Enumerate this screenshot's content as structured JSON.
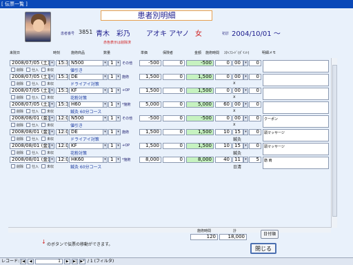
{
  "window": {
    "title": "[ 伝票一覧 ]"
  },
  "header": {
    "title": "患者別明細",
    "patient_no_label": "患者番号",
    "patient_no": "3851",
    "name_kanji": "青木　彩乃",
    "name_kana": "アオキ アヤノ",
    "gender": "女",
    "first_visit_label": "初診",
    "first_visit": "2004/10/01 ～",
    "red_note": "赤色表示は削除済"
  },
  "columns": {
    "date": "来院日",
    "time": "時刻",
    "item": "施術商品",
    "qty": "数量",
    "unit_price": "単価",
    "ins": "保険者",
    "amount": "金額",
    "duration": "施術時間",
    "staff": "ｽﾀｯﾌｺｰﾄﾞ(ﾎﾟｲﾝﾄ)",
    "memo": "明細メモ"
  },
  "checkbox_labels": {
    "del": "削除",
    "stock": "仕入",
    "unpaid": "未収"
  },
  "rows": [
    {
      "date": "2008/07/05 (土)",
      "time": "15:30",
      "code": "N500",
      "qty": "1",
      "tag": "その他",
      "unit": "-500",
      "ins": "0",
      "amount": "-500",
      "dur": "0",
      "staff": "00",
      "pt": "0",
      "sub": "値引き",
      "sub2": "",
      "memo": ""
    },
    {
      "date": "2008/07/05 (土)",
      "time": "15:30",
      "code": "DE",
      "qty": "1",
      "tag": "施術",
      "unit": "1,500",
      "ins": "0",
      "amount": "1,500",
      "dur": "0",
      "staff": "00",
      "pt": "0",
      "sub": "ドライアイ対策",
      "sub2": "x",
      "memo": ""
    },
    {
      "date": "2008/07/05 (土)",
      "time": "15:30",
      "code": "KF",
      "qty": "1",
      "tag": "+OP",
      "unit": "1,500",
      "ins": "0",
      "amount": "1,500",
      "dur": "0",
      "staff": "00",
      "pt": "0",
      "sub": "花粉対策",
      "sub2": "x",
      "memo": ""
    },
    {
      "date": "2008/07/05 (土)",
      "time": "15:30",
      "code": "H60",
      "qty": "1",
      "tag": "*施術",
      "unit": "5,000",
      "ins": "0",
      "amount": "5,000",
      "dur": "60",
      "staff": "00",
      "pt": "0",
      "sub": "鍼灸 60分コース",
      "sub2": "x",
      "memo": ""
    },
    {
      "date": "2008/08/01 (金)",
      "time": "12:00",
      "code": "N500",
      "qty": "1",
      "tag": "その他",
      "unit": "-500",
      "ins": "0",
      "amount": "-500",
      "dur": "0",
      "staff": "00",
      "pt": "0",
      "sub": "値引き",
      "sub2": "x",
      "memo": "クーポン"
    },
    {
      "date": "2008/08/01 (金)",
      "time": "12:00",
      "code": "DE",
      "qty": "1",
      "tag": "施術",
      "unit": "1,500",
      "ins": "0",
      "amount": "1,500",
      "dur": "10",
      "staff": "15",
      "pt": "0",
      "sub": "ドライアイ対策",
      "sub2": "鍼灸",
      "memo": "頭マッサージ"
    },
    {
      "date": "2008/08/01 (金)",
      "time": "12:00",
      "code": "KF",
      "qty": "1",
      "tag": "+OP",
      "unit": "1,500",
      "ins": "0",
      "amount": "1,500",
      "dur": "10",
      "staff": "15",
      "pt": "0",
      "sub": "花粉対策",
      "sub2": "鍼灸",
      "memo": "頭マッサージ"
    },
    {
      "date": "2008/08/01 (金)",
      "time": "12:00",
      "code": "HK60",
      "qty": "1",
      "tag": "*施術",
      "unit": "8,000",
      "ins": "0",
      "amount": "8,000",
      "dur": "40",
      "staff": "11",
      "pt": "5",
      "sub": "鍼灸 60分コース",
      "sub2": "日清",
      "memo": "筋 肩"
    }
  ],
  "totals": {
    "duration_label": "施術時間",
    "duration": "120",
    "sum_label": "計",
    "sum": "18,000"
  },
  "buttons": {
    "receipt": "日付順",
    "close": "閉じる"
  },
  "footer_note": "のボタンで伝票の移動ができます。",
  "nav": {
    "label": "レコード:",
    "current": "1",
    "of": "/ 1 (フィルタ)"
  }
}
